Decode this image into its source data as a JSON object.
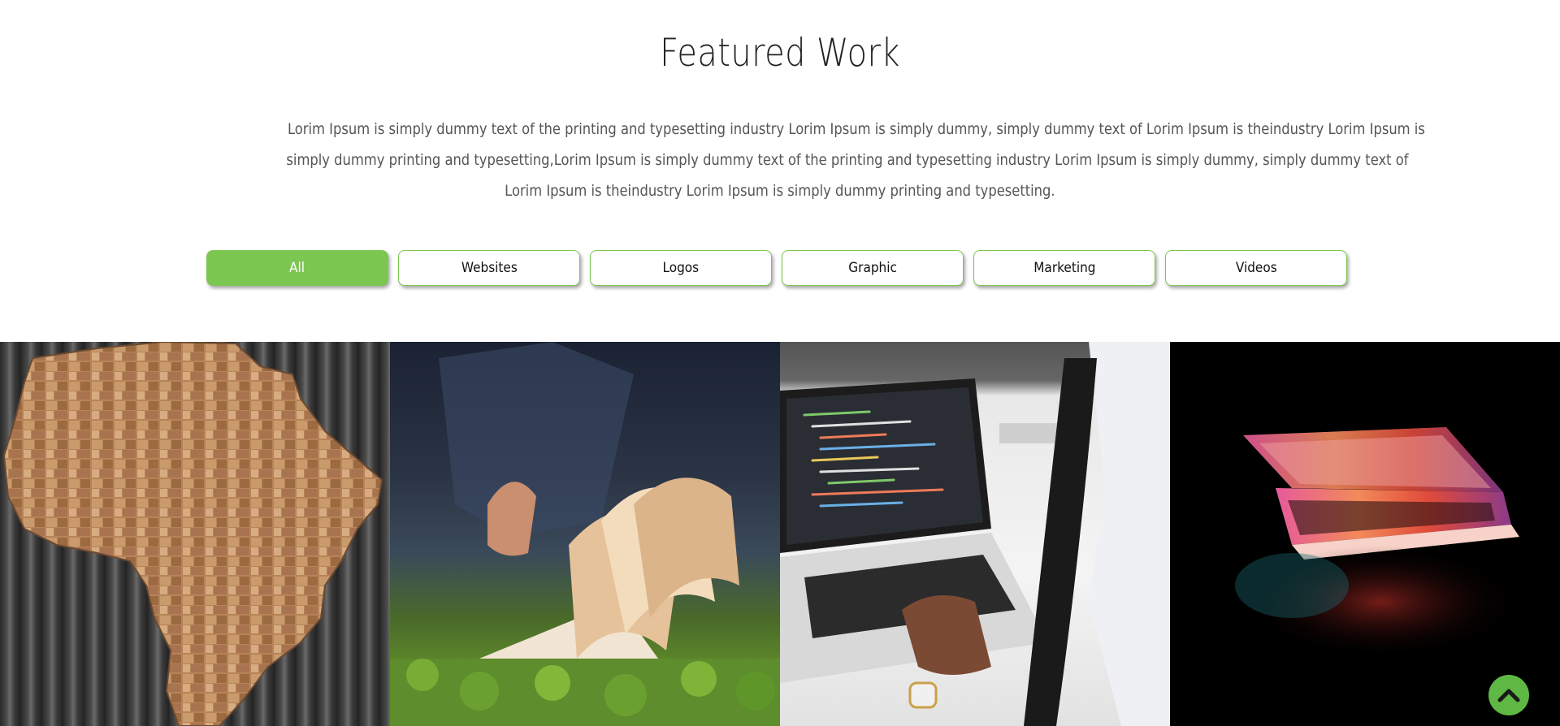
{
  "section": {
    "title": "Featured Work",
    "description_lines": [
      "Lorim Ipsum is simply dummy text of the printing and typesetting industry Lorim Ipsum is simply dummy, simply dummy text of Lorim Ipsum is theindustry Lorim Ipsum is",
      "simply dummy printing and typesetting,Lorim Ipsum is simply dummy text of the printing and typesetting industry Lorim Ipsum is simply dummy, simply dummy text of",
      "Lorim Ipsum is theindustry Lorim Ipsum is simply dummy printing and typesetting."
    ]
  },
  "filters": [
    {
      "label": "All",
      "active": true
    },
    {
      "label": "Websites",
      "active": false
    },
    {
      "label": "Logos",
      "active": false
    },
    {
      "label": "Graphic",
      "active": false
    },
    {
      "label": "Marketing",
      "active": false
    },
    {
      "label": "Videos",
      "active": false
    }
  ],
  "gallery": [
    {
      "icon": "africa-map-wood-image"
    },
    {
      "icon": "open-book-grass-image"
    },
    {
      "icon": "laptop-coding-image"
    },
    {
      "icon": "glowing-laptop-image"
    }
  ],
  "scroll_top": {
    "icon": "chevron-up-icon"
  },
  "colors": {
    "accent": "#7cc652",
    "scroll_button": "#5fb844",
    "title": "#222222",
    "text": "#555555"
  }
}
